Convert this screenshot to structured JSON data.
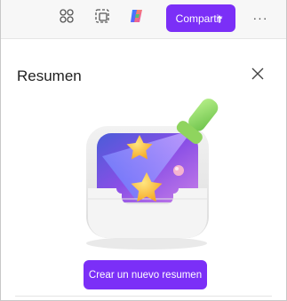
{
  "toolbar": {
    "icons": {
      "apps": "apps-grid-icon",
      "select": "dashed-select-icon",
      "copilot": "copilot-icon"
    },
    "share_label": "Compartir",
    "more_label": "···"
  },
  "panel": {
    "title": "Resumen",
    "close_icon": "close-icon",
    "illustration": "broom-cleaning-tray-illustration",
    "create_label": "Crear un nuevo resumen"
  },
  "colors": {
    "accent": "#7b2ff7",
    "toolbar_bg": "#f7f7f7"
  }
}
